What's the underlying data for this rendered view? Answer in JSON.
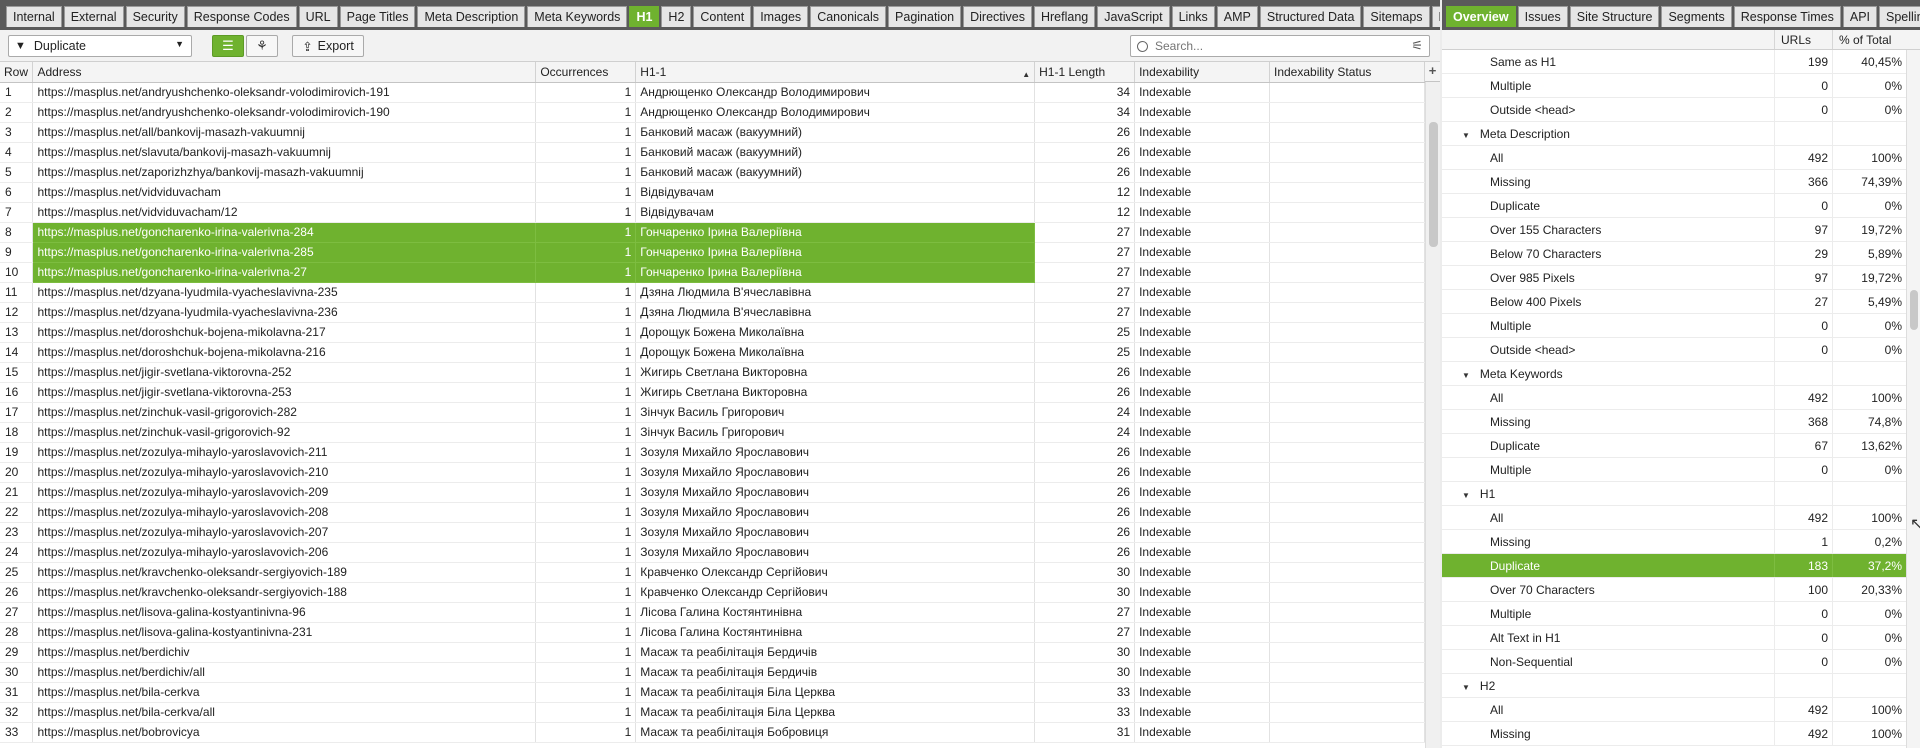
{
  "left_tabs": [
    {
      "label": "Internal",
      "active": false
    },
    {
      "label": "External",
      "active": false
    },
    {
      "label": "Security",
      "active": false
    },
    {
      "label": "Response Codes",
      "active": false
    },
    {
      "label": "URL",
      "active": false
    },
    {
      "label": "Page Titles",
      "active": false
    },
    {
      "label": "Meta Description",
      "active": false
    },
    {
      "label": "Meta Keywords",
      "active": false
    },
    {
      "label": "H1",
      "active": true
    },
    {
      "label": "H2",
      "active": false
    },
    {
      "label": "Content",
      "active": false
    },
    {
      "label": "Images",
      "active": false
    },
    {
      "label": "Canonicals",
      "active": false
    },
    {
      "label": "Pagination",
      "active": false
    },
    {
      "label": "Directives",
      "active": false
    },
    {
      "label": "Hreflang",
      "active": false
    },
    {
      "label": "JavaScript",
      "active": false
    },
    {
      "label": "Links",
      "active": false
    },
    {
      "label": "AMP",
      "active": false
    },
    {
      "label": "Structured Data",
      "active": false
    },
    {
      "label": "Sitemaps",
      "active": false
    },
    {
      "label": "PageSpeed",
      "active": false
    }
  ],
  "right_tabs": [
    {
      "label": "Overview",
      "active": true
    },
    {
      "label": "Issues",
      "active": false
    },
    {
      "label": "Site Structure",
      "active": false
    },
    {
      "label": "Segments",
      "active": false
    },
    {
      "label": "Response Times",
      "active": false
    },
    {
      "label": "API",
      "active": false
    },
    {
      "label": "Spelling",
      "active": false
    }
  ],
  "toolbar": {
    "filter_value": "Duplicate",
    "export_label": "Export",
    "search_placeholder": "Search..."
  },
  "grid": {
    "columns": [
      "Row",
      "Address",
      "Occurrences",
      "H1-1",
      "H1-1 Length",
      "Indexability",
      "Indexability Status"
    ],
    "rows": [
      {
        "row": "1",
        "address": "https://masplus.net/andryushchenko-oleksandr-volodimirovich-191",
        "occ": "1",
        "h1": "Андрющенко Олександр Володимирович",
        "len": "34",
        "idx": "Indexable",
        "status": "",
        "sel": false
      },
      {
        "row": "2",
        "address": "https://masplus.net/andryushchenko-oleksandr-volodimirovich-190",
        "occ": "1",
        "h1": "Андрющенко Олександр Володимирович",
        "len": "34",
        "idx": "Indexable",
        "status": "",
        "sel": false
      },
      {
        "row": "3",
        "address": "https://masplus.net/all/bankovij-masazh-vakuumnij",
        "occ": "1",
        "h1": "Банковий масаж (вакуумний)",
        "len": "26",
        "idx": "Indexable",
        "status": "",
        "sel": false
      },
      {
        "row": "4",
        "address": "https://masplus.net/slavuta/bankovij-masazh-vakuumnij",
        "occ": "1",
        "h1": "Банковий масаж (вакуумний)",
        "len": "26",
        "idx": "Indexable",
        "status": "",
        "sel": false
      },
      {
        "row": "5",
        "address": "https://masplus.net/zaporizhzhya/bankovij-masazh-vakuumnij",
        "occ": "1",
        "h1": "Банковий масаж (вакуумний)",
        "len": "26",
        "idx": "Indexable",
        "status": "",
        "sel": false
      },
      {
        "row": "6",
        "address": "https://masplus.net/vidviduvacham",
        "occ": "1",
        "h1": "Відвідувачам",
        "len": "12",
        "idx": "Indexable",
        "status": "",
        "sel": false
      },
      {
        "row": "7",
        "address": "https://masplus.net/vidviduvacham/12",
        "occ": "1",
        "h1": "Відвідувачам",
        "len": "12",
        "idx": "Indexable",
        "status": "",
        "sel": false
      },
      {
        "row": "8",
        "address": "https://masplus.net/goncharenko-irina-valerivna-284",
        "occ": "1",
        "h1": "Гончаренко Ірина Валеріївна",
        "len": "27",
        "idx": "Indexable",
        "status": "",
        "sel": true
      },
      {
        "row": "9",
        "address": "https://masplus.net/goncharenko-irina-valerivna-285",
        "occ": "1",
        "h1": "Гончаренко Ірина Валеріївна",
        "len": "27",
        "idx": "Indexable",
        "status": "",
        "sel": true
      },
      {
        "row": "10",
        "address": "https://masplus.net/goncharenko-irina-valerivna-27",
        "occ": "1",
        "h1": "Гончаренко Ірина Валеріївна",
        "len": "27",
        "idx": "Indexable",
        "status": "",
        "sel": true
      },
      {
        "row": "11",
        "address": "https://masplus.net/dzyana-lyudmila-vyacheslavivna-235",
        "occ": "1",
        "h1": "Дзяна Людмила В'ячеславівна",
        "len": "27",
        "idx": "Indexable",
        "status": "",
        "sel": false
      },
      {
        "row": "12",
        "address": "https://masplus.net/dzyana-lyudmila-vyacheslavivna-236",
        "occ": "1",
        "h1": "Дзяна Людмила В'ячеславівна",
        "len": "27",
        "idx": "Indexable",
        "status": "",
        "sel": false
      },
      {
        "row": "13",
        "address": "https://masplus.net/doroshchuk-bojena-mikolavna-217",
        "occ": "1",
        "h1": "Дорощук Божена Миколаївна",
        "len": "25",
        "idx": "Indexable",
        "status": "",
        "sel": false
      },
      {
        "row": "14",
        "address": "https://masplus.net/doroshchuk-bojena-mikolavna-216",
        "occ": "1",
        "h1": "Дорощук Божена Миколаївна",
        "len": "25",
        "idx": "Indexable",
        "status": "",
        "sel": false
      },
      {
        "row": "15",
        "address": "https://masplus.net/jigir-svetlana-viktorovna-252",
        "occ": "1",
        "h1": "Жигирь Светлана Викторовна",
        "len": "26",
        "idx": "Indexable",
        "status": "",
        "sel": false
      },
      {
        "row": "16",
        "address": "https://masplus.net/jigir-svetlana-viktorovna-253",
        "occ": "1",
        "h1": "Жигирь Светлана Викторовна",
        "len": "26",
        "idx": "Indexable",
        "status": "",
        "sel": false
      },
      {
        "row": "17",
        "address": "https://masplus.net/zinchuk-vasil-grigorovich-282",
        "occ": "1",
        "h1": "Зінчук Василь Григорович",
        "len": "24",
        "idx": "Indexable",
        "status": "",
        "sel": false
      },
      {
        "row": "18",
        "address": "https://masplus.net/zinchuk-vasil-grigorovich-92",
        "occ": "1",
        "h1": "Зінчук Василь Григорович",
        "len": "24",
        "idx": "Indexable",
        "status": "",
        "sel": false
      },
      {
        "row": "19",
        "address": "https://masplus.net/zozulya-mihaylo-yaroslavovich-211",
        "occ": "1",
        "h1": "Зозуля Михайло Ярославович",
        "len": "26",
        "idx": "Indexable",
        "status": "",
        "sel": false
      },
      {
        "row": "20",
        "address": "https://masplus.net/zozulya-mihaylo-yaroslavovich-210",
        "occ": "1",
        "h1": "Зозуля Михайло Ярославович",
        "len": "26",
        "idx": "Indexable",
        "status": "",
        "sel": false
      },
      {
        "row": "21",
        "address": "https://masplus.net/zozulya-mihaylo-yaroslavovich-209",
        "occ": "1",
        "h1": "Зозуля Михайло Ярославович",
        "len": "26",
        "idx": "Indexable",
        "status": "",
        "sel": false
      },
      {
        "row": "22",
        "address": "https://masplus.net/zozulya-mihaylo-yaroslavovich-208",
        "occ": "1",
        "h1": "Зозуля Михайло Ярославович",
        "len": "26",
        "idx": "Indexable",
        "status": "",
        "sel": false
      },
      {
        "row": "23",
        "address": "https://masplus.net/zozulya-mihaylo-yaroslavovich-207",
        "occ": "1",
        "h1": "Зозуля Михайло Ярославович",
        "len": "26",
        "idx": "Indexable",
        "status": "",
        "sel": false
      },
      {
        "row": "24",
        "address": "https://masplus.net/zozulya-mihaylo-yaroslavovich-206",
        "occ": "1",
        "h1": "Зозуля Михайло Ярославович",
        "len": "26",
        "idx": "Indexable",
        "status": "",
        "sel": false
      },
      {
        "row": "25",
        "address": "https://masplus.net/kravchenko-oleksandr-sergiyovich-189",
        "occ": "1",
        "h1": "Кравченко Олександр Сергійович",
        "len": "30",
        "idx": "Indexable",
        "status": "",
        "sel": false
      },
      {
        "row": "26",
        "address": "https://masplus.net/kravchenko-oleksandr-sergiyovich-188",
        "occ": "1",
        "h1": "Кравченко Олександр Сергійович",
        "len": "30",
        "idx": "Indexable",
        "status": "",
        "sel": false
      },
      {
        "row": "27",
        "address": "https://masplus.net/lisova-galina-kostyantinivna-96",
        "occ": "1",
        "h1": "Лісова Галина Костянтинівна",
        "len": "27",
        "idx": "Indexable",
        "status": "",
        "sel": false
      },
      {
        "row": "28",
        "address": "https://masplus.net/lisova-galina-kostyantinivna-231",
        "occ": "1",
        "h1": "Лісова Галина Костянтинівна",
        "len": "27",
        "idx": "Indexable",
        "status": "",
        "sel": false
      },
      {
        "row": "29",
        "address": "https://masplus.net/berdichiv",
        "occ": "1",
        "h1": "Масаж та реабілітація Бердичів",
        "len": "30",
        "idx": "Indexable",
        "status": "",
        "sel": false
      },
      {
        "row": "30",
        "address": "https://masplus.net/berdichiv/all",
        "occ": "1",
        "h1": "Масаж та реабілітація Бердичів",
        "len": "30",
        "idx": "Indexable",
        "status": "",
        "sel": false
      },
      {
        "row": "31",
        "address": "https://masplus.net/bila-cerkva",
        "occ": "1",
        "h1": "Масаж та реабілітація Біла Церква",
        "len": "33",
        "idx": "Indexable",
        "status": "",
        "sel": false
      },
      {
        "row": "32",
        "address": "https://masplus.net/bila-cerkva/all",
        "occ": "1",
        "h1": "Масаж та реабілітація Біла Церква",
        "len": "33",
        "idx": "Indexable",
        "status": "",
        "sel": false
      },
      {
        "row": "33",
        "address": "https://masplus.net/bobrovicya",
        "occ": "1",
        "h1": "Масаж та реабілітація Бобровиця",
        "len": "31",
        "idx": "Indexable",
        "status": "",
        "sel": false
      }
    ]
  },
  "overview": {
    "col_urls": "URLs",
    "col_pct": "% of Total",
    "rows": [
      {
        "type": "item",
        "label": "Same as H1",
        "urls": "199",
        "pct": "40,45%",
        "sel": false
      },
      {
        "type": "item",
        "label": "Multiple",
        "urls": "0",
        "pct": "0%",
        "sel": false
      },
      {
        "type": "item",
        "label": "Outside <head>",
        "urls": "0",
        "pct": "0%",
        "sel": false
      },
      {
        "type": "group",
        "label": "Meta Description",
        "urls": "",
        "pct": "",
        "sel": false
      },
      {
        "type": "item",
        "label": "All",
        "urls": "492",
        "pct": "100%",
        "sel": false
      },
      {
        "type": "item",
        "label": "Missing",
        "urls": "366",
        "pct": "74,39%",
        "sel": false
      },
      {
        "type": "item",
        "label": "Duplicate",
        "urls": "0",
        "pct": "0%",
        "sel": false
      },
      {
        "type": "item",
        "label": "Over 155 Characters",
        "urls": "97",
        "pct": "19,72%",
        "sel": false
      },
      {
        "type": "item",
        "label": "Below 70 Characters",
        "urls": "29",
        "pct": "5,89%",
        "sel": false
      },
      {
        "type": "item",
        "label": "Over 985 Pixels",
        "urls": "97",
        "pct": "19,72%",
        "sel": false
      },
      {
        "type": "item",
        "label": "Below 400 Pixels",
        "urls": "27",
        "pct": "5,49%",
        "sel": false
      },
      {
        "type": "item",
        "label": "Multiple",
        "urls": "0",
        "pct": "0%",
        "sel": false
      },
      {
        "type": "item",
        "label": "Outside <head>",
        "urls": "0",
        "pct": "0%",
        "sel": false
      },
      {
        "type": "group",
        "label": "Meta Keywords",
        "urls": "",
        "pct": "",
        "sel": false
      },
      {
        "type": "item",
        "label": "All",
        "urls": "492",
        "pct": "100%",
        "sel": false
      },
      {
        "type": "item",
        "label": "Missing",
        "urls": "368",
        "pct": "74,8%",
        "sel": false
      },
      {
        "type": "item",
        "label": "Duplicate",
        "urls": "67",
        "pct": "13,62%",
        "sel": false
      },
      {
        "type": "item",
        "label": "Multiple",
        "urls": "0",
        "pct": "0%",
        "sel": false
      },
      {
        "type": "group",
        "label": "H1",
        "urls": "",
        "pct": "",
        "sel": false
      },
      {
        "type": "item",
        "label": "All",
        "urls": "492",
        "pct": "100%",
        "sel": false
      },
      {
        "type": "item",
        "label": "Missing",
        "urls": "1",
        "pct": "0,2%",
        "sel": false
      },
      {
        "type": "item",
        "label": "Duplicate",
        "urls": "183",
        "pct": "37,2%",
        "sel": true
      },
      {
        "type": "item",
        "label": "Over 70 Characters",
        "urls": "100",
        "pct": "20,33%",
        "sel": false
      },
      {
        "type": "item",
        "label": "Multiple",
        "urls": "0",
        "pct": "0%",
        "sel": false
      },
      {
        "type": "item",
        "label": "Alt Text in H1",
        "urls": "0",
        "pct": "0%",
        "sel": false
      },
      {
        "type": "item",
        "label": "Non-Sequential",
        "urls": "0",
        "pct": "0%",
        "sel": false
      },
      {
        "type": "group",
        "label": "H2",
        "urls": "",
        "pct": "",
        "sel": false
      },
      {
        "type": "item",
        "label": "All",
        "urls": "492",
        "pct": "100%",
        "sel": false
      },
      {
        "type": "item",
        "label": "Missing",
        "urls": "492",
        "pct": "100%",
        "sel": false
      }
    ]
  },
  "icons": {
    "filter": "funnel-icon",
    "list_view": "list-view-icon",
    "tree_view": "tree-view-icon",
    "export": "export-icon",
    "search": "search-icon",
    "search_options": "sliders-icon",
    "sort": "sort-ascending-icon",
    "add_column": "plus-icon",
    "tab_overflow": "chevron-down-icon",
    "group_caret": "caret-down-icon"
  },
  "colors": {
    "accent": "#6fb22f",
    "tabbar": "#5a5a5a"
  }
}
